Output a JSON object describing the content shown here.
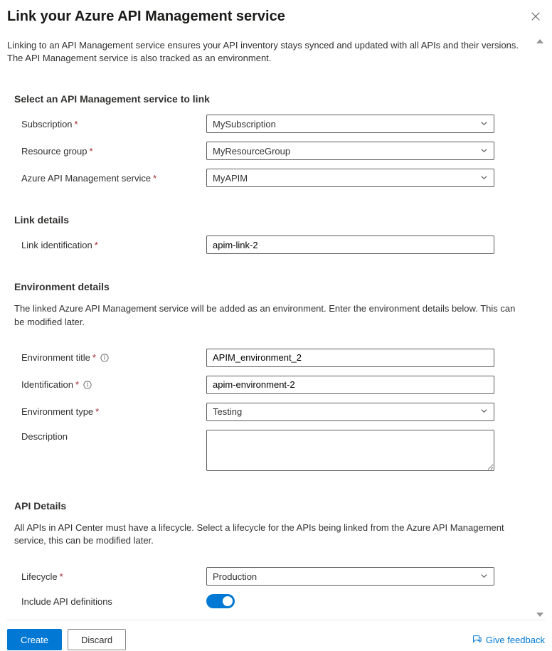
{
  "header": {
    "title": "Link your Azure API Management service"
  },
  "intro": "Linking to an API Management service ensures your API inventory stays synced and updated with all APIs and their versions. The API Management service is also tracked as an environment.",
  "section_select": {
    "title": "Select an API Management service to link",
    "subscription_label": "Subscription",
    "subscription_value": "MySubscription",
    "rg_label": "Resource group",
    "rg_value": "MyResourceGroup",
    "apim_label": "Azure API Management service",
    "apim_value": "MyAPIM"
  },
  "section_link": {
    "title": "Link details",
    "ident_label": "Link identification",
    "ident_value": "apim-link-2"
  },
  "section_env": {
    "title": "Environment details",
    "desc": "The linked Azure API Management service will be added as an environment. Enter the environment details below. This can be modified later.",
    "env_title_label": "Environment title",
    "env_title_value": "APIM_environment_2",
    "env_id_label": "Identification",
    "env_id_value": "apim-environment-2",
    "env_type_label": "Environment type",
    "env_type_value": "Testing",
    "desc_label": "Description",
    "desc_value": ""
  },
  "section_api": {
    "title": "API Details",
    "desc": "All APIs in API Center must have a lifecycle. Select a lifecycle for the APIs being linked from the Azure API Management service, this can be modified later.",
    "lifecycle_label": "Lifecycle",
    "lifecycle_value": "Production",
    "include_label": "Include API definitions",
    "include_on": true
  },
  "footer": {
    "create": "Create",
    "discard": "Discard",
    "feedback": "Give feedback"
  }
}
